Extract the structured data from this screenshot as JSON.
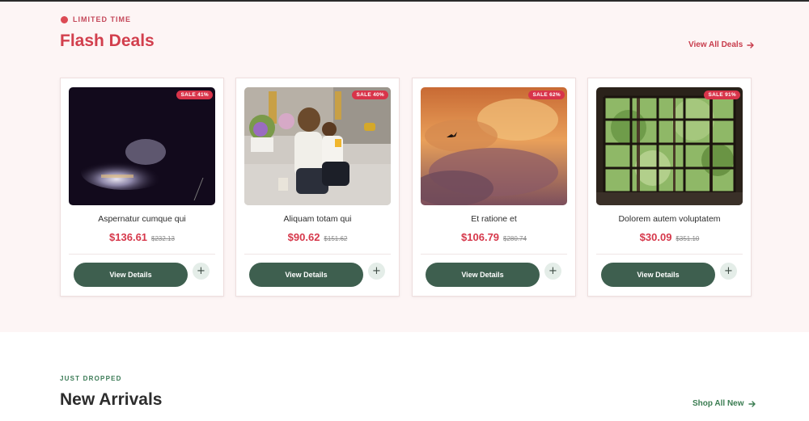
{
  "flash_deals": {
    "eyebrow": "LIMITED TIME",
    "title": "Flash Deals",
    "view_all_label": "View All Deals",
    "accent_color": "#d23f4d",
    "products": [
      {
        "name": "Aspernatur cumque qui",
        "price": "$136.61",
        "old_price": "$232.13",
        "badge": "SALE 41%",
        "image": "dark-smoke-photo",
        "button_label": "View Details",
        "add_icon": "plus-icon"
      },
      {
        "name": "Aliquam totam qui",
        "price": "$90.62",
        "old_price": "$151.62",
        "badge": "SALE 40%",
        "image": "mother-child-street-photo",
        "button_label": "View Details",
        "add_icon": "plus-icon"
      },
      {
        "name": "Et ratione et",
        "price": "$106.79",
        "old_price": "$280.74",
        "badge": "SALE 62%",
        "image": "sunset-clouds-bird-photo",
        "button_label": "View Details",
        "add_icon": "plus-icon"
      },
      {
        "name": "Dolorem autem voluptatem",
        "price": "$30.09",
        "old_price": "$351.10",
        "badge": "SALE 91%",
        "image": "window-trees-photo",
        "button_label": "View Details",
        "add_icon": "plus-icon"
      }
    ]
  },
  "new_arrivals": {
    "eyebrow": "JUST DROPPED",
    "title": "New Arrivals",
    "shop_all_label": "Shop All New",
    "accent_color": "#3b7d52"
  },
  "colors": {
    "button": "#3e5f4f",
    "sale_badge": "#d8344a",
    "section_bg": "#fdf5f5"
  }
}
